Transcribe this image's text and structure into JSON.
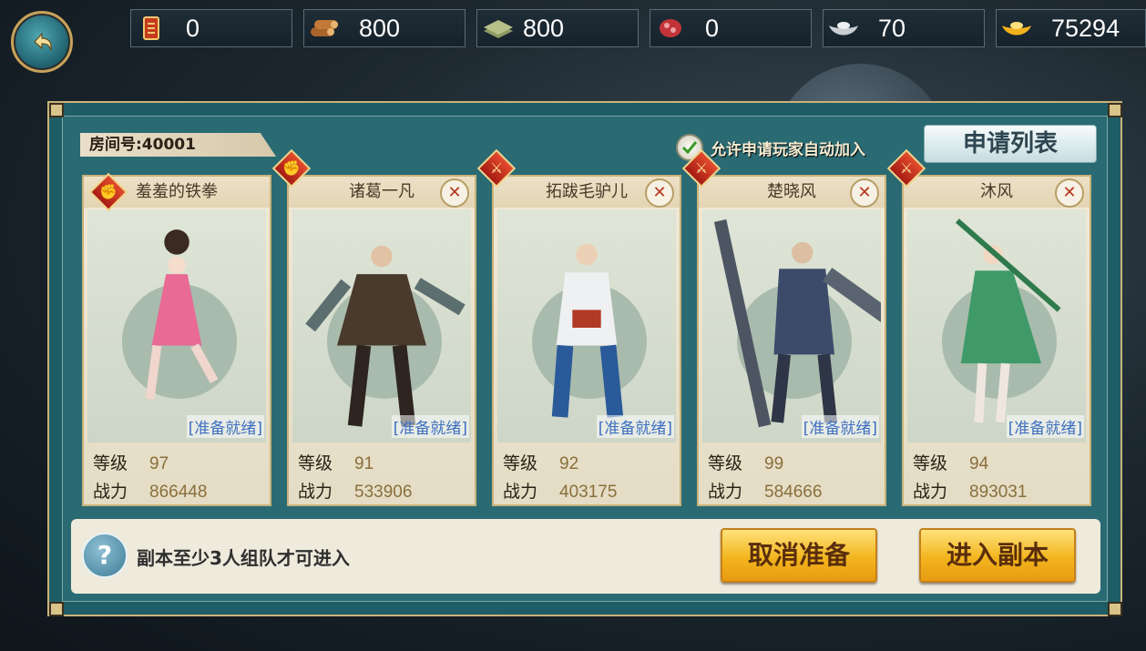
{
  "resources": [
    {
      "icon": "token-icon",
      "value": "0"
    },
    {
      "icon": "wood-icon",
      "value": "800"
    },
    {
      "icon": "cloth-icon",
      "value": "800"
    },
    {
      "icon": "meat-icon",
      "value": "0"
    },
    {
      "icon": "silver-ingot-icon",
      "value": "70"
    },
    {
      "icon": "gold-ingot-icon",
      "value": "75294"
    }
  ],
  "room": {
    "label": "房间号:40001"
  },
  "auto_join": {
    "label": "允许申请玩家自动加入",
    "checked": true
  },
  "apply_list_label": "申请列表",
  "members": [
    {
      "name": "羞羞的铁拳",
      "ready": "[准备就绪]",
      "level_label": "等级",
      "level": "97",
      "power_label": "战力",
      "power": "866448",
      "role_icon": "fist-icon",
      "badge": "✊",
      "kick": false
    },
    {
      "name": "诸葛一凡",
      "ready": "[准备就绪]",
      "level_label": "等级",
      "level": "91",
      "power_label": "战力",
      "power": "533906",
      "role_icon": "fist-icon",
      "badge": "✊",
      "kick": true
    },
    {
      "name": "拓跋毛驴儿",
      "ready": "[准备就绪]",
      "level_label": "等级",
      "level": "92",
      "power_label": "战力",
      "power": "403175",
      "role_icon": "sword-icon",
      "badge": "⚔",
      "kick": true
    },
    {
      "name": "楚晓风",
      "ready": "[准备就绪]",
      "level_label": "等级",
      "level": "99",
      "power_label": "战力",
      "power": "584666",
      "role_icon": "sword-icon",
      "badge": "⚔",
      "kick": true
    },
    {
      "name": "沐风",
      "ready": "[准备就绪]",
      "level_label": "等级",
      "level": "94",
      "power_label": "战力",
      "power": "893031",
      "role_icon": "sword-icon",
      "badge": "⚔",
      "kick": true
    }
  ],
  "tip": "副本至少3人组队才可进入",
  "buttons": {
    "cancel_ready": "取消准备",
    "enter": "进入副本"
  },
  "colors": {
    "panel": "#1f5d66",
    "gold": "#f3b51e",
    "ready_text": "#3d6fbf"
  }
}
